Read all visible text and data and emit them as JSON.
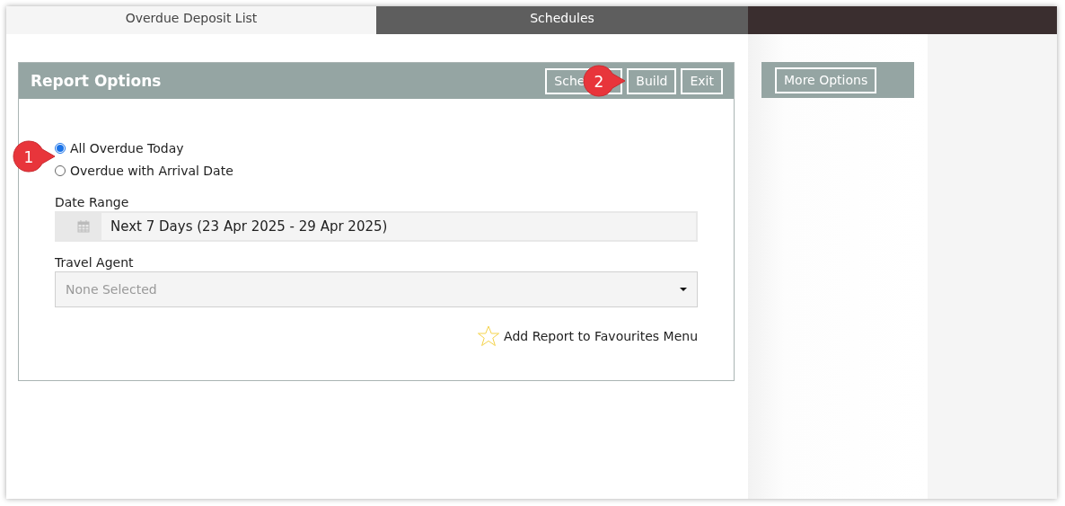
{
  "tabs": [
    {
      "label": "Overdue Deposit List",
      "selected": true
    },
    {
      "label": "Schedules",
      "selected": false
    }
  ],
  "report_options": {
    "title": "Report Options",
    "buttons": [
      {
        "label": "Sche"
      },
      {
        "label": "Build"
      },
      {
        "label": "Exit"
      }
    ],
    "radios": [
      {
        "label": "All Overdue Today",
        "selected": true
      },
      {
        "label": "Overdue with Arrival Date",
        "selected": false
      }
    ],
    "date_range": {
      "label": "Date Range",
      "value": "Next 7 Days (23 Apr 2025 - 29 Apr 2025)"
    },
    "travel_agent": {
      "label": "Travel Agent",
      "placeholder": "None Selected"
    },
    "favourites": {
      "label": "Add Report to Favourites Menu"
    }
  },
  "side_panel": {
    "button": "More Options"
  },
  "callouts": [
    {
      "label": "1"
    },
    {
      "label": "2"
    }
  ]
}
